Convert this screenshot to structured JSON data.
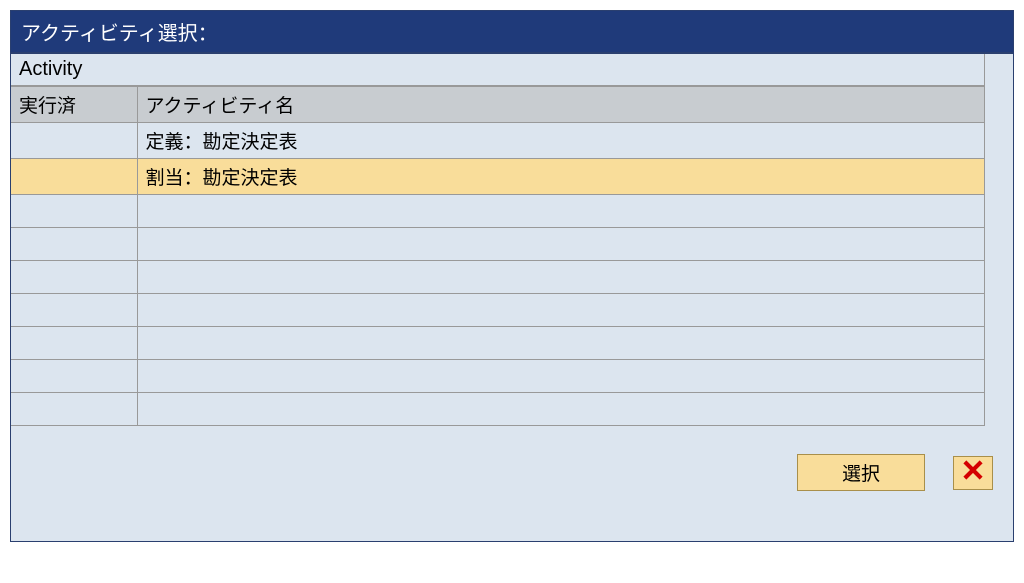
{
  "title": "アクティビティ選択：",
  "subtitle": "Activity",
  "columns": {
    "executed": "実行済",
    "activity_name": "アクティビティ名"
  },
  "rows": [
    {
      "executed": "",
      "name": "定義：勘定決定表",
      "selected": false
    },
    {
      "executed": "",
      "name": "割当：勘定決定表",
      "selected": true
    },
    {
      "executed": "",
      "name": "",
      "selected": false
    },
    {
      "executed": "",
      "name": "",
      "selected": false
    },
    {
      "executed": "",
      "name": "",
      "selected": false
    },
    {
      "executed": "",
      "name": "",
      "selected": false
    },
    {
      "executed": "",
      "name": "",
      "selected": false
    },
    {
      "executed": "",
      "name": "",
      "selected": false
    },
    {
      "executed": "",
      "name": "",
      "selected": false
    }
  ],
  "buttons": {
    "select": "選択"
  }
}
